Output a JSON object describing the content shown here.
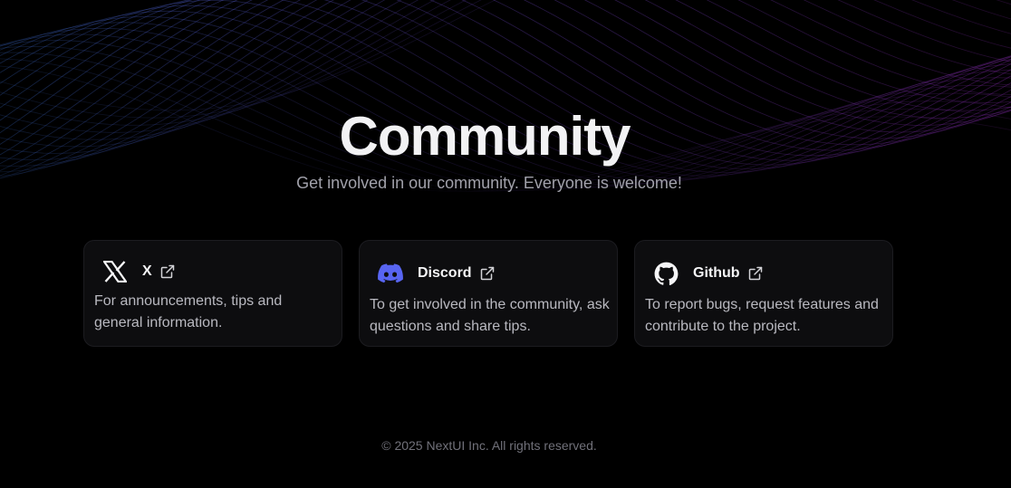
{
  "hero": {
    "title": "Community",
    "subtitle": "Get involved in our community. Everyone is welcome!"
  },
  "cards": [
    {
      "title": "X",
      "icon": "x-logo-icon",
      "description": "For announcements, tips and general information."
    },
    {
      "title": "Discord",
      "icon": "discord-icon",
      "description": "To get involved in the community, ask questions and share tips."
    },
    {
      "title": "Github",
      "icon": "github-icon",
      "description": "To report bugs, request features and contribute to the project."
    }
  ],
  "footer": {
    "copyright": "© 2025 NextUI Inc. All rights reserved."
  },
  "colors": {
    "background": "#000000",
    "card_background": "#0d0d0f",
    "discord_brand": "#5865F2",
    "wave_purple": "#7c3aed",
    "wave_blue": "#3b82f6"
  }
}
